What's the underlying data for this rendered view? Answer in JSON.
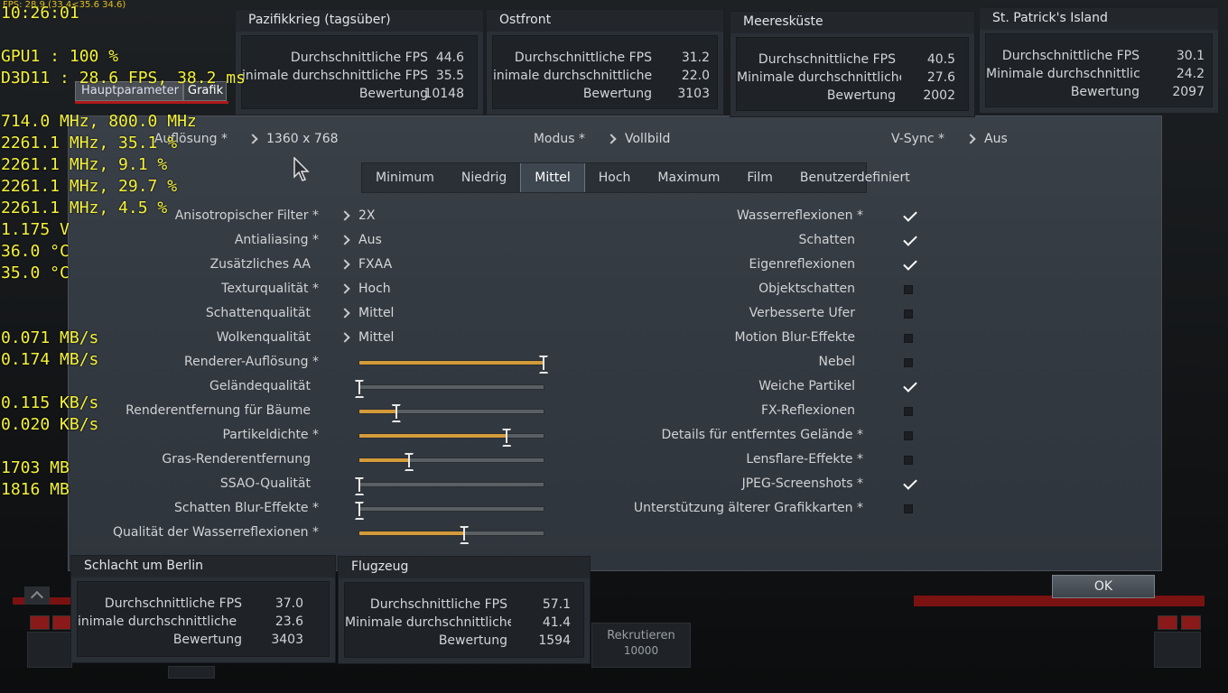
{
  "overlay": {
    "top_line": "FPS: 28.9 (33.4<35.6 34.6)",
    "time": "10:26:01",
    "gpu": "GPU1   : 100 %",
    "d3d": "D3D11  : 28.6 FPS, 38.2 ms",
    "lines": [
      "714.0 MHz, 800.0 MHz",
      "2261.1 MHz, 35.1 %",
      "2261.1 MHz,  9.1 %",
      "2261.1 MHz, 29.7 %",
      "2261.1 MHz,  4.5 %",
      "1.175 V",
      "36.0 °C",
      "35.0 °C"
    ],
    "net": [
      "0.071 MB/s",
      "0.174 MB/s"
    ],
    "net2": [
      "0.115 KB/s",
      "0.020 KB/s"
    ],
    "mem": [
      "1703 MB",
      "1816 MB"
    ]
  },
  "background": {
    "tab_main": "Hauptparameter",
    "tab_graphics": "Grafik",
    "recruit_label": "Rekrutieren",
    "recruit_cost": "10000"
  },
  "top_settings": {
    "resolution_label": "Auflösung *",
    "resolution_value": "1360 x 768",
    "mode_label": "Modus *",
    "mode_value": "Vollbild",
    "vsync_label": "V-Sync *",
    "vsync_value": "Aus"
  },
  "presets": [
    "Minimum",
    "Niedrig",
    "Mittel",
    "Hoch",
    "Maximum",
    "Film",
    "Benutzerdefiniert"
  ],
  "active_preset": "Mittel",
  "selects": [
    {
      "label": "Anisotropischer Filter *",
      "value": "2X"
    },
    {
      "label": "Antialiasing *",
      "value": "Aus"
    },
    {
      "label": "Zusätzliches AA",
      "value": "FXAA"
    },
    {
      "label": "Texturqualität *",
      "value": "Hoch"
    },
    {
      "label": "Schattenqualität",
      "value": "Mittel"
    },
    {
      "label": "Wolkenqualität",
      "value": "Mittel"
    }
  ],
  "sliders": [
    {
      "label": "Renderer-Auflösung *",
      "level": 1.0
    },
    {
      "label": "Geländequalität",
      "level": 0.0
    },
    {
      "label": "Renderentfernung für Bäume",
      "level": 0.2
    },
    {
      "label": "Partikeldichte *",
      "level": 0.8
    },
    {
      "label": "Gras-Renderentfernung",
      "level": 0.27
    },
    {
      "label": "SSAO-Qualität",
      "level": 0.0
    },
    {
      "label": "Schatten Blur-Effekte *",
      "level": 0.0
    },
    {
      "label": "Qualität der Wasserreflexionen *",
      "level": 0.57
    }
  ],
  "toggles": [
    {
      "label": "Wasserreflexionen *",
      "checked": true
    },
    {
      "label": "Schatten",
      "checked": true
    },
    {
      "label": "Eigenreflexionen",
      "checked": true
    },
    {
      "label": "Objektschatten",
      "checked": false
    },
    {
      "label": "Verbesserte Ufer",
      "checked": false
    },
    {
      "label": "Motion Blur-Effekte",
      "checked": false
    },
    {
      "label": "Nebel",
      "checked": false
    },
    {
      "label": "Weiche Partikel",
      "checked": true
    },
    {
      "label": "FX-Reflexionen",
      "checked": false
    },
    {
      "label": "Details für entferntes Gelände *",
      "checked": false
    },
    {
      "label": "Lensflare-Effekte *",
      "checked": false
    },
    {
      "label": "JPEG-Screenshots *",
      "checked": true
    },
    {
      "label": "Unterstützung älterer Grafikkarten *",
      "checked": false
    }
  ],
  "benchmarks": [
    {
      "title": "Pazifikkrieg (tagsüber)",
      "rows": [
        [
          "Durchschnittliche FPS",
          "44.6"
        ],
        [
          "inimale durchschnittliche FPS",
          "35.5"
        ],
        [
          "Bewertung",
          "10148"
        ]
      ]
    },
    {
      "title": "Ostfront",
      "rows": [
        [
          "Durchschnittliche FPS",
          "31.2"
        ],
        [
          "inimale durchschnittliche FPS",
          "22.0"
        ],
        [
          "Bewertung",
          "3103"
        ]
      ]
    },
    {
      "title": "Meeresküste",
      "rows": [
        [
          "Durchschnittliche FPS",
          "40.5"
        ],
        [
          "Minimale durchschnittliche F",
          "27.6"
        ],
        [
          "Bewertung",
          "2002"
        ]
      ]
    },
    {
      "title": "St. Patrick's Island",
      "rows": [
        [
          "Durchschnittliche FPS",
          "30.1"
        ],
        [
          "Minimale durchschnittliche F",
          "24.2"
        ],
        [
          "Bewertung",
          "2097"
        ]
      ]
    },
    {
      "title": "Schlacht um Berlin",
      "rows": [
        [
          "Durchschnittliche FPS",
          "37.0"
        ],
        [
          "inimale durchschnittliche FPS",
          "23.6"
        ],
        [
          "Bewertung",
          "3403"
        ]
      ]
    },
    {
      "title": "Flugzeug",
      "rows": [
        [
          "Durchschnittliche FPS",
          "57.1"
        ],
        [
          "Minimale durchschnittliche F",
          "41.4"
        ],
        [
          "Bewertung",
          "1594"
        ]
      ]
    }
  ],
  "ok_label": "OK",
  "colors": {
    "accent": "#d49b3a",
    "overlay_text": "#f5f23a",
    "background_red": "#7a1212"
  }
}
